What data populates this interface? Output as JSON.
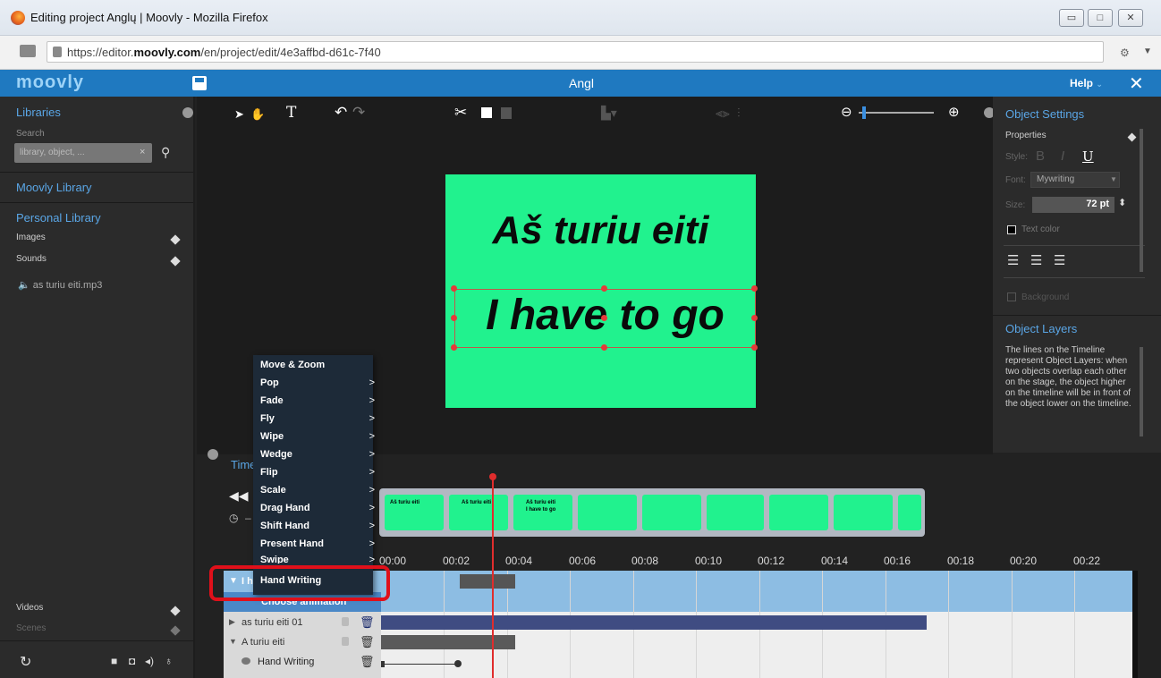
{
  "browser": {
    "title": "Editing project Anglų | Moovly - Mozilla Firefox",
    "url_prefix": "https://editor.",
    "url_domain": "moovly.com",
    "url_path": "/en/project/edit/4e3affbd-d61c-7f40"
  },
  "header": {
    "logo": "moovly",
    "project_title": "Angl",
    "help": "Help"
  },
  "libraries": {
    "title": "Libraries",
    "search_label": "Search",
    "search_placeholder": "library, object, ...",
    "moovly_library": "Moovly Library",
    "personal_library": "Personal Library",
    "images": "Images",
    "sounds": "Sounds",
    "sound_file": "as turiu eiti.mp3",
    "videos": "Videos",
    "scenes": "Scenes"
  },
  "stage": {
    "text1": "Aš turiu eiti",
    "text2": "I have to go",
    "background_color": "#21f28e"
  },
  "object_settings": {
    "title": "Object Settings",
    "properties": "Properties",
    "style_label": "Style:",
    "style_b": "B",
    "style_i": "I",
    "style_u": "U",
    "font_label": "Font:",
    "font_value": "Mywriting",
    "size_label": "Size:",
    "size_value": "72 pt",
    "text_color": "Text color",
    "background": "Background"
  },
  "object_layers": {
    "title": "Object Layers",
    "description": "The lines on the Timeline represent Object Layers: when two objects overlap each other on the stage, the object higher on the timeline will be in front of the object lower on the timeline."
  },
  "timeline": {
    "title": "Timeline",
    "ticks": [
      "00:00",
      "00:02",
      "00:04",
      "00:06",
      "00:08",
      "00:10",
      "00:12",
      "00:14",
      "00:16",
      "00:18",
      "00:20",
      "00:22"
    ],
    "thumb1": "Aš turiu eiti",
    "thumb3a": "Aš turiu eiti",
    "thumb3b": "I have to go",
    "layers": [
      {
        "label": "I have to go"
      },
      {
        "label": "Choose animation"
      },
      {
        "label": "as turiu eiti 01"
      },
      {
        "label": "A turiu eiti"
      },
      {
        "label": "Hand Writing"
      }
    ]
  },
  "animation_menu": {
    "items": [
      "Move & Zoom",
      "Pop",
      "Fade",
      "Fly",
      "Wipe",
      "Wedge",
      "Flip",
      "Scale",
      "Drag Hand",
      "Shift Hand",
      "Present Hand",
      "Swipe",
      "Hand Writing"
    ],
    "arrow": ">"
  }
}
